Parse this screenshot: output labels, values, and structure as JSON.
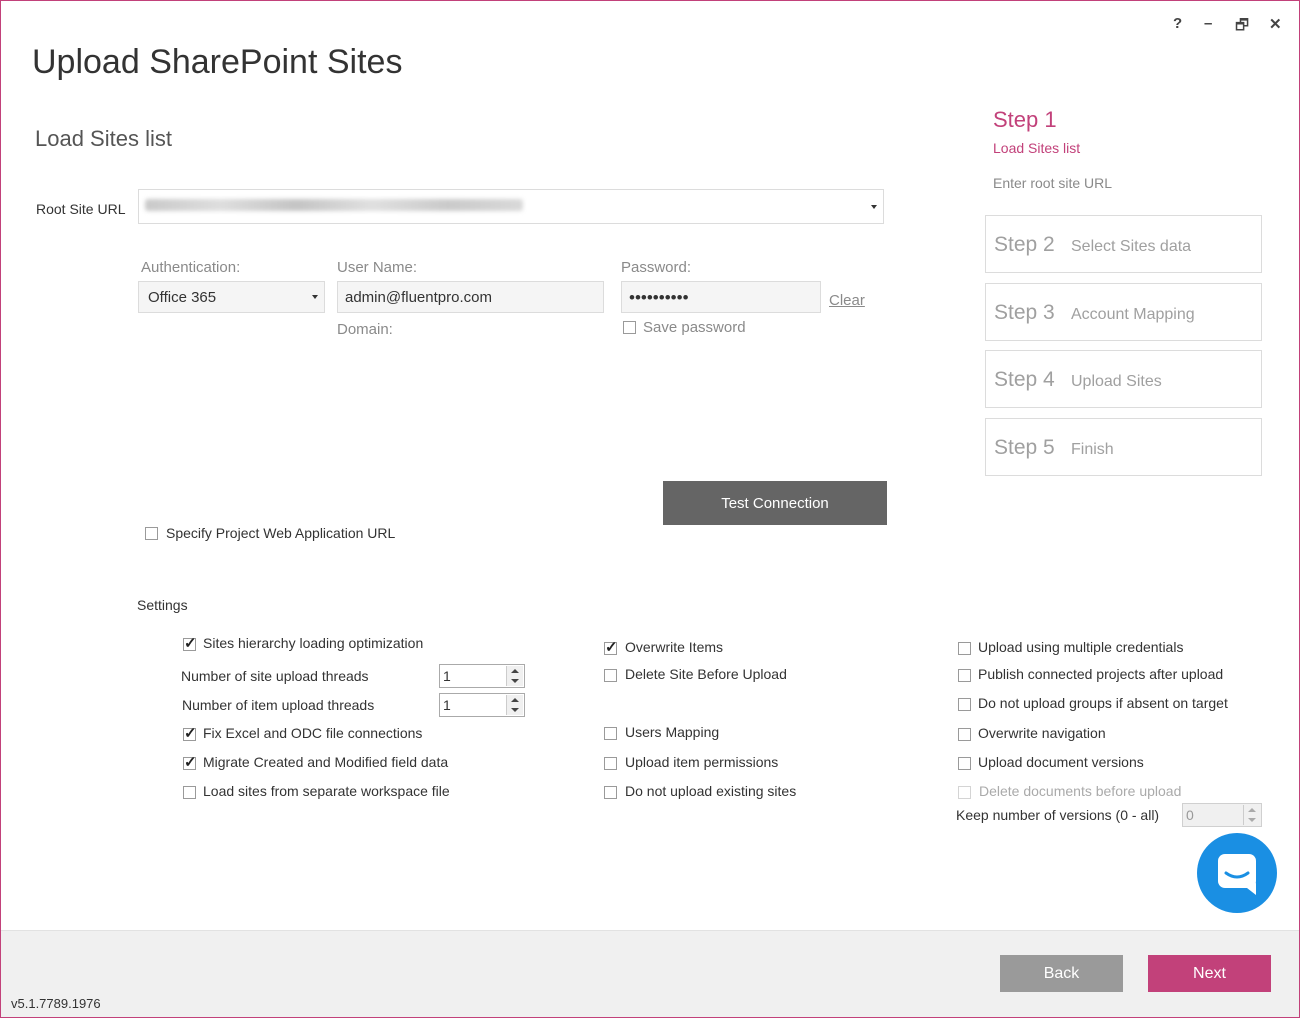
{
  "window_controls": {
    "help": "?",
    "minimize": "–",
    "restore": "🗗",
    "close": "✕"
  },
  "title": "Upload SharePoint Sites",
  "subtitle": "Load Sites list",
  "root_site": {
    "label": "Root Site URL"
  },
  "auth": {
    "auth_label": "Authentication:",
    "auth_value": "Office 365",
    "user_label": "User Name:",
    "user_value": "admin@fluentpro.com",
    "domain_label": "Domain:",
    "password_label": "Password:",
    "password_value": "••••••••••",
    "clear_link": "Clear",
    "save_password": "Save password"
  },
  "test_connection": "Test Connection",
  "pwa": {
    "label": "Specify Project Web Application URL",
    "checked": false
  },
  "settings": {
    "title": "Settings",
    "col1": {
      "hierarchy": "Sites hierarchy loading optimization",
      "site_threads_label": "Number of site upload threads",
      "site_threads_value": "1",
      "item_threads_label": "Number of item upload threads",
      "item_threads_value": "1",
      "fix_excel": "Fix Excel and ODC file connections",
      "migrate_created": "Migrate Created and Modified field data",
      "load_sites_file": "Load sites from separate workspace file"
    },
    "col2": {
      "overwrite_items": "Overwrite Items",
      "delete_site": "Delete Site Before Upload",
      "users_mapping": "Users Mapping",
      "upload_permissions": "Upload item permissions",
      "no_upload_existing": "Do not upload existing sites"
    },
    "col3": {
      "multiple_credentials": "Upload using multiple credentials",
      "publish_projects": "Publish connected projects after upload",
      "no_upload_groups": "Do not upload groups if absent on target",
      "overwrite_navigation": "Overwrite navigation",
      "upload_versions": "Upload document versions",
      "delete_documents": "Delete documents before upload",
      "keep_versions_label": "Keep number of versions (0 - all)",
      "keep_versions_value": "0"
    }
  },
  "steps": {
    "active": {
      "num": "Step 1",
      "name": "Load Sites list",
      "hint": "Enter root site URL"
    },
    "items": [
      {
        "num": "Step 2",
        "name": "Select Sites data"
      },
      {
        "num": "Step 3",
        "name": "Account Mapping"
      },
      {
        "num": "Step 4",
        "name": "Upload Sites"
      },
      {
        "num": "Step 5",
        "name": "Finish"
      }
    ]
  },
  "footer": {
    "back": "Back",
    "next": "Next",
    "version": "v5.1.7789.1976"
  },
  "colors": {
    "accent": "#c2417a",
    "chat": "#1a8fe3",
    "test_button": "#656565",
    "back_button": "#9a9a9a"
  },
  "icons": {
    "chat": "chat-bubble-icon"
  }
}
